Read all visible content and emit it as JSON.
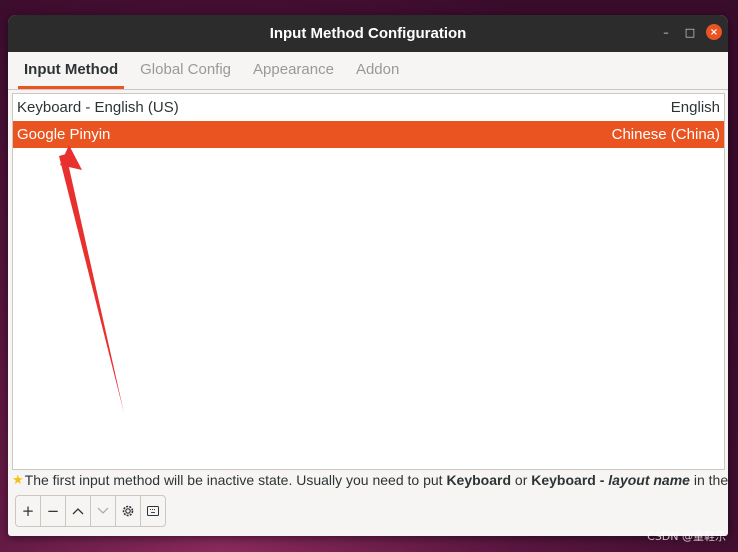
{
  "window": {
    "title": "Input Method Configuration",
    "controls": {
      "minimize": "–",
      "maximize": "□",
      "close": "×"
    }
  },
  "tabs": [
    {
      "label": "Input Method",
      "active": true
    },
    {
      "label": "Global Config",
      "active": false
    },
    {
      "label": "Appearance",
      "active": false
    },
    {
      "label": "Addon",
      "active": false
    }
  ],
  "input_methods": [
    {
      "name": "Keyboard - English (US)",
      "language": "English",
      "selected": false
    },
    {
      "name": "Google Pinyin",
      "language": "Chinese (China)",
      "selected": true
    }
  ],
  "hint": {
    "icon": "star-icon",
    "prefix": "The first input method will be inactive state. Usually you need to put ",
    "keyword1": "Keyboard",
    "middle": " or ",
    "keyword2": "Keyboard - ",
    "keyword2_italic": "layout name",
    "suffix": " in the first place."
  },
  "toolbar": [
    {
      "name": "add-button",
      "icon": "plus-icon",
      "glyph": "+"
    },
    {
      "name": "remove-button",
      "icon": "minus-icon",
      "glyph": "−"
    },
    {
      "name": "move-up-button",
      "icon": "chevron-up-icon",
      "glyph": "︿"
    },
    {
      "name": "move-down-button",
      "icon": "chevron-down-icon",
      "glyph": "﹀"
    },
    {
      "name": "configure-button",
      "icon": "gear-icon",
      "glyph": "⚙"
    },
    {
      "name": "keyboard-layout-button",
      "icon": "keyboard-icon",
      "glyph": "⌨"
    }
  ],
  "watermark": "CSDN @童鞋乐",
  "colors": {
    "accent": "#e95420",
    "titlebar": "#2c2c2c",
    "annotation_arrow": "#e8312f"
  }
}
